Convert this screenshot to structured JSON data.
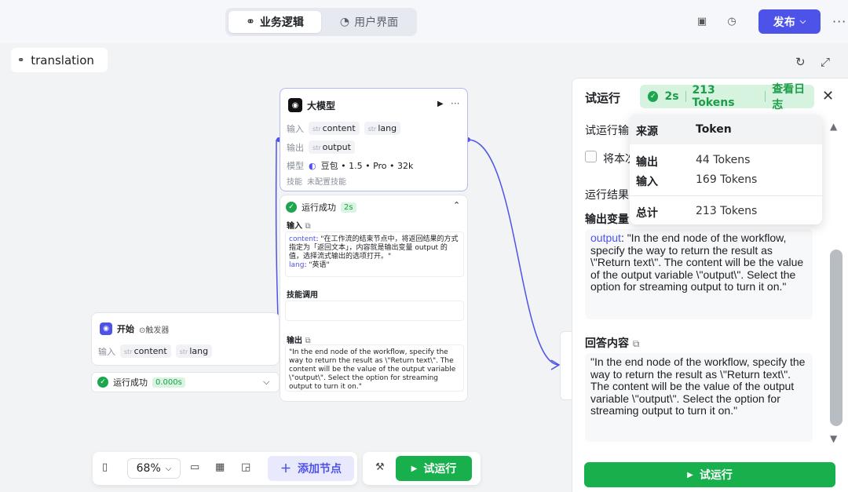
{
  "topbar": {
    "tabs": [
      {
        "label": "业务逻辑",
        "icon": "logic-icon"
      },
      {
        "label": "用户界面",
        "icon": "palette-icon"
      }
    ],
    "publish_label": "发布"
  },
  "workflow": {
    "name": "translation"
  },
  "llm_node": {
    "title": "大模型",
    "input_label": "输入",
    "inputs": [
      "content",
      "lang"
    ],
    "output_label": "输出",
    "outputs": [
      "output"
    ],
    "model_label": "模型",
    "model_value": "豆包 • 1.5 • Pro • 32k",
    "skill_label": "技能",
    "skill_value": "未配置技能",
    "type_tag": "str"
  },
  "llm_result": {
    "status": "运行成功",
    "duration": "2s",
    "input_header": "输入",
    "input_content_key": "content",
    "input_content_value": ": \"在工作流的结束节点中，将返回结果的方式指定为「返回文本」，内容就是输出变量 output 的值，选择流式输出的选项打开。\"",
    "input_lang_key": "lang",
    "input_lang_value": ": \"英语\"",
    "skills_header": "技能调用",
    "output_header": "输出",
    "output_text": "\"In the end node of the workflow, specify the way to return the result as \\\"Return text\\\". The content will be the value of the output variable \\\"output\\\". Select the option for streaming output to turn it on.\""
  },
  "start_node": {
    "title": "开始",
    "trigger_label": "触发器",
    "input_label": "输入",
    "inputs": [
      "content",
      "lang"
    ],
    "status": "运行成功",
    "duration": "0.000s"
  },
  "toolbar": {
    "zoom": "68%",
    "add_node_label": "添加节点",
    "run_label": "试运行"
  },
  "test_panel": {
    "title": "试运行",
    "duration": "2s",
    "tokens": "213 Tokens",
    "view_log": "查看日志",
    "input_label": "试运行输",
    "checkbox_label": "将本次",
    "result_label": "运行结果",
    "output_var_label": "输出变量",
    "output_key": "output",
    "output_value": ": \"In the end node of the workflow, specify the way to return the result as \\\"Return text\\\". The content will be the value of the output variable \\\"output\\\". Select the option for streaming output to turn it on.\"",
    "answer_label": "回答内容",
    "answer_value": "\"In the end node of the workflow, specify the way to return the result as \\\"Return text\\\". The content will be the value of the output variable \\\"output\\\". Select the option for streaming output to turn it on.\"",
    "run_button": "试运行"
  },
  "token_popup": {
    "col_source": "来源",
    "col_token": "Token",
    "rows": [
      {
        "source": "输出",
        "token": "44 Tokens"
      },
      {
        "source": "输入",
        "token": "169 Tokens"
      }
    ],
    "total_label": "总计",
    "total_value": "213 Tokens"
  },
  "colors": {
    "brand": "#4d53e8",
    "success": "#17b04d"
  }
}
